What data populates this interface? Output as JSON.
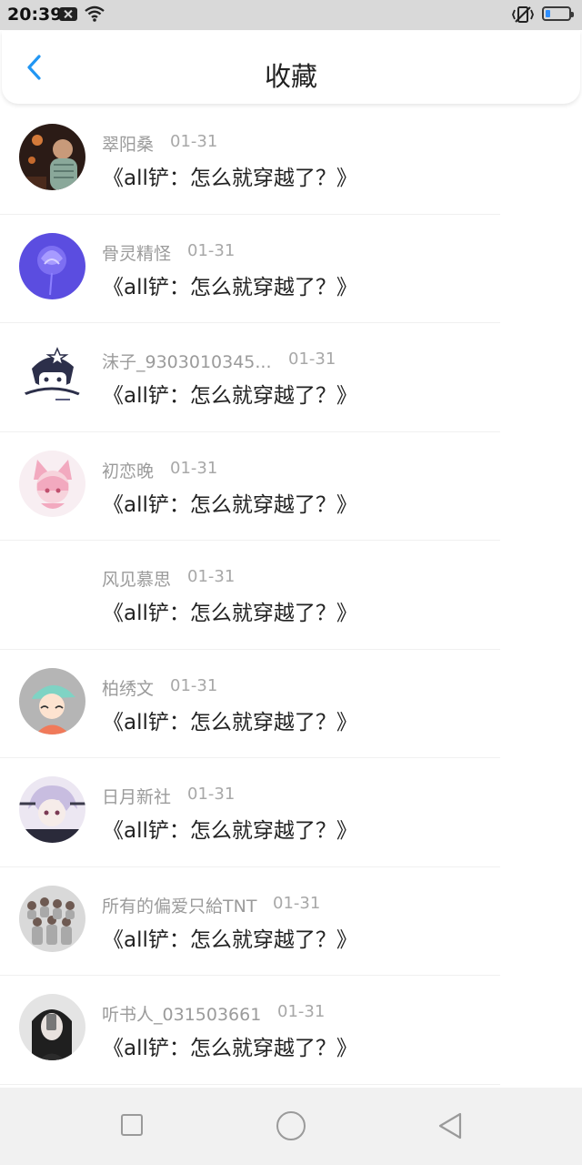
{
  "status_bar": {
    "time": "20:39",
    "icons": [
      "notification-x-icon",
      "wifi-icon",
      "vibrate-icon",
      "battery-icon"
    ],
    "battery_level": 0.2,
    "accent_color": "#2f8fff"
  },
  "header": {
    "title": "收藏",
    "back_icon": "chevron-left-icon",
    "accent_color": "#2196f3"
  },
  "favorites": [
    {
      "user": "翠阳桑",
      "time": "01-31",
      "title": "《all铲：怎么就穿越了？》",
      "avatar": "photo"
    },
    {
      "user": "骨灵精怪",
      "time": "01-31",
      "title": "《all铲：怎么就穿越了？》",
      "avatar": "purple-flower"
    },
    {
      "user": "沫子_9303010345...",
      "time": "01-31",
      "title": "《all铲：怎么就穿越了？》",
      "avatar": "anime-sketch"
    },
    {
      "user": "初恋晚",
      "time": "01-31",
      "title": "《all铲：怎么就穿越了？》",
      "avatar": "pink-anime"
    },
    {
      "user": "风见慕思",
      "time": "01-31",
      "title": "《all铲：怎么就穿越了？》",
      "avatar": "none"
    },
    {
      "user": "柏绣文",
      "time": "01-31",
      "title": "《all铲：怎么就穿越了？》",
      "avatar": "cartoon-cap"
    },
    {
      "user": "日月新社",
      "time": "01-31",
      "title": "《all铲：怎么就穿越了？》",
      "avatar": "anime-boy"
    },
    {
      "user": "所有的偏爱只給TNT",
      "time": "01-31",
      "title": "《all铲：怎么就穿越了？》",
      "avatar": "group-photo"
    },
    {
      "user": "听书人_031503661",
      "time": "01-31",
      "title": "《all铲：怎么就穿越了？》",
      "avatar": "mirror-selfie"
    }
  ],
  "nav_bar": {
    "icons": [
      "recent-apps-icon",
      "home-icon",
      "back-icon"
    ]
  }
}
